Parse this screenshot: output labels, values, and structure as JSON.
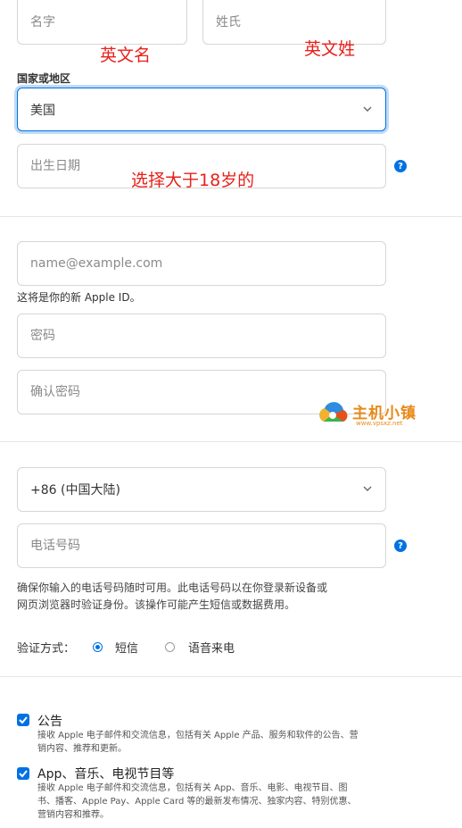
{
  "name_section": {
    "first_name_placeholder": "名字",
    "last_name_placeholder": "姓氏",
    "first_name_note": "英文名",
    "last_name_note": "英文姓"
  },
  "country": {
    "label": "国家或地区",
    "value": "美国"
  },
  "birthday": {
    "placeholder": "出生日期",
    "note": "选择大于18岁的"
  },
  "account": {
    "email_placeholder": "name@example.com",
    "email_hint": "这将是你的新 Apple ID。",
    "password_placeholder": "密码",
    "confirm_password_placeholder": "确认密码"
  },
  "watermark": {
    "title": "主机小镇",
    "subtitle": "www.vpsxz.net"
  },
  "phone": {
    "country_code": "+86 (中国大陆)",
    "number_placeholder": "电话号码",
    "note_line1": "确保你输入的电话号码随时可用。此电话号码以在你登录新设备或",
    "note_line2": "网页浏览器时验证身份。该操作可能产生短信或数据费用。"
  },
  "verification": {
    "label": "验证方式：",
    "option_sms": "短信",
    "option_voice": "语音来电",
    "selected": "短信"
  },
  "subscriptions": {
    "announcements_title": "公告",
    "announcements_desc_1": "接收 Apple 电子邮件和交流信息，包括有关 Apple 产品、服务和软件的公告、营",
    "announcements_desc_2": "销内容、推荐和更新。",
    "media_title": "App、音乐、电视节目等",
    "media_desc_1": "接收 Apple 电子邮件和交流信息，包括有关 App、音乐、电影、电视节目、图",
    "media_desc_2": "书、播客、Apple Pay、Apple Card 等的最新发布情况、独家内容、特别优惠、",
    "media_desc_3": "营销内容和推荐。"
  },
  "help_icon_glyph": "?",
  "colors": {
    "accent": "#0071e3",
    "annotation": "#e8201a",
    "watermark": "#e88a1a"
  }
}
